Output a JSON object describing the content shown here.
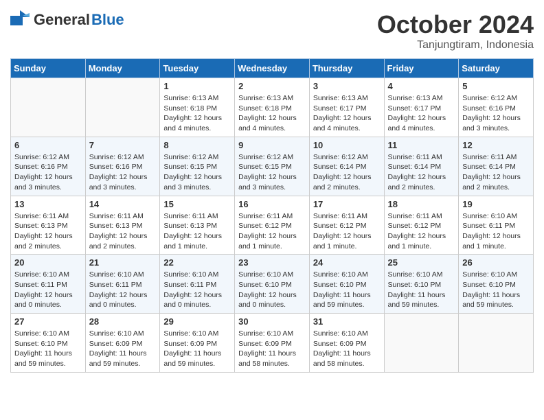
{
  "header": {
    "logo_general": "General",
    "logo_blue": "Blue",
    "month_title": "October 2024",
    "location": "Tanjungtiram, Indonesia"
  },
  "weekdays": [
    "Sunday",
    "Monday",
    "Tuesday",
    "Wednesday",
    "Thursday",
    "Friday",
    "Saturday"
  ],
  "weeks": [
    [
      {
        "day": "",
        "info": ""
      },
      {
        "day": "",
        "info": ""
      },
      {
        "day": "1",
        "info": "Sunrise: 6:13 AM\nSunset: 6:18 PM\nDaylight: 12 hours and 4 minutes."
      },
      {
        "day": "2",
        "info": "Sunrise: 6:13 AM\nSunset: 6:18 PM\nDaylight: 12 hours and 4 minutes."
      },
      {
        "day": "3",
        "info": "Sunrise: 6:13 AM\nSunset: 6:17 PM\nDaylight: 12 hours and 4 minutes."
      },
      {
        "day": "4",
        "info": "Sunrise: 6:13 AM\nSunset: 6:17 PM\nDaylight: 12 hours and 4 minutes."
      },
      {
        "day": "5",
        "info": "Sunrise: 6:12 AM\nSunset: 6:16 PM\nDaylight: 12 hours and 3 minutes."
      }
    ],
    [
      {
        "day": "6",
        "info": "Sunrise: 6:12 AM\nSunset: 6:16 PM\nDaylight: 12 hours and 3 minutes."
      },
      {
        "day": "7",
        "info": "Sunrise: 6:12 AM\nSunset: 6:16 PM\nDaylight: 12 hours and 3 minutes."
      },
      {
        "day": "8",
        "info": "Sunrise: 6:12 AM\nSunset: 6:15 PM\nDaylight: 12 hours and 3 minutes."
      },
      {
        "day": "9",
        "info": "Sunrise: 6:12 AM\nSunset: 6:15 PM\nDaylight: 12 hours and 3 minutes."
      },
      {
        "day": "10",
        "info": "Sunrise: 6:12 AM\nSunset: 6:14 PM\nDaylight: 12 hours and 2 minutes."
      },
      {
        "day": "11",
        "info": "Sunrise: 6:11 AM\nSunset: 6:14 PM\nDaylight: 12 hours and 2 minutes."
      },
      {
        "day": "12",
        "info": "Sunrise: 6:11 AM\nSunset: 6:14 PM\nDaylight: 12 hours and 2 minutes."
      }
    ],
    [
      {
        "day": "13",
        "info": "Sunrise: 6:11 AM\nSunset: 6:13 PM\nDaylight: 12 hours and 2 minutes."
      },
      {
        "day": "14",
        "info": "Sunrise: 6:11 AM\nSunset: 6:13 PM\nDaylight: 12 hours and 2 minutes."
      },
      {
        "day": "15",
        "info": "Sunrise: 6:11 AM\nSunset: 6:13 PM\nDaylight: 12 hours and 1 minute."
      },
      {
        "day": "16",
        "info": "Sunrise: 6:11 AM\nSunset: 6:12 PM\nDaylight: 12 hours and 1 minute."
      },
      {
        "day": "17",
        "info": "Sunrise: 6:11 AM\nSunset: 6:12 PM\nDaylight: 12 hours and 1 minute."
      },
      {
        "day": "18",
        "info": "Sunrise: 6:11 AM\nSunset: 6:12 PM\nDaylight: 12 hours and 1 minute."
      },
      {
        "day": "19",
        "info": "Sunrise: 6:10 AM\nSunset: 6:11 PM\nDaylight: 12 hours and 1 minute."
      }
    ],
    [
      {
        "day": "20",
        "info": "Sunrise: 6:10 AM\nSunset: 6:11 PM\nDaylight: 12 hours and 0 minutes."
      },
      {
        "day": "21",
        "info": "Sunrise: 6:10 AM\nSunset: 6:11 PM\nDaylight: 12 hours and 0 minutes."
      },
      {
        "day": "22",
        "info": "Sunrise: 6:10 AM\nSunset: 6:11 PM\nDaylight: 12 hours and 0 minutes."
      },
      {
        "day": "23",
        "info": "Sunrise: 6:10 AM\nSunset: 6:10 PM\nDaylight: 12 hours and 0 minutes."
      },
      {
        "day": "24",
        "info": "Sunrise: 6:10 AM\nSunset: 6:10 PM\nDaylight: 11 hours and 59 minutes."
      },
      {
        "day": "25",
        "info": "Sunrise: 6:10 AM\nSunset: 6:10 PM\nDaylight: 11 hours and 59 minutes."
      },
      {
        "day": "26",
        "info": "Sunrise: 6:10 AM\nSunset: 6:10 PM\nDaylight: 11 hours and 59 minutes."
      }
    ],
    [
      {
        "day": "27",
        "info": "Sunrise: 6:10 AM\nSunset: 6:10 PM\nDaylight: 11 hours and 59 minutes."
      },
      {
        "day": "28",
        "info": "Sunrise: 6:10 AM\nSunset: 6:09 PM\nDaylight: 11 hours and 59 minutes."
      },
      {
        "day": "29",
        "info": "Sunrise: 6:10 AM\nSunset: 6:09 PM\nDaylight: 11 hours and 59 minutes."
      },
      {
        "day": "30",
        "info": "Sunrise: 6:10 AM\nSunset: 6:09 PM\nDaylight: 11 hours and 58 minutes."
      },
      {
        "day": "31",
        "info": "Sunrise: 6:10 AM\nSunset: 6:09 PM\nDaylight: 11 hours and 58 minutes."
      },
      {
        "day": "",
        "info": ""
      },
      {
        "day": "",
        "info": ""
      }
    ]
  ]
}
